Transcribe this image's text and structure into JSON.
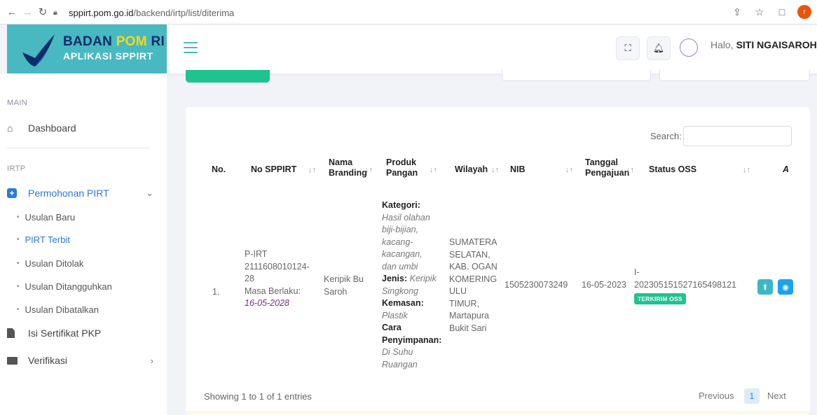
{
  "browser": {
    "url_domain": "sppirt.pom.go.id",
    "url_path": "/backend/irtp/list/diterima",
    "profile_initial": "r"
  },
  "logo": {
    "line1_a": "BADAN",
    "line1_b": "POM",
    "line1_c": "RI",
    "line2": "APLIKASI SPPIRT"
  },
  "header": {
    "greeting_prefix": "Halo,",
    "user_name": "SITI NGAISAROH"
  },
  "sidebar": {
    "section_main": "MAIN",
    "dashboard": "Dashboard",
    "section_irtp": "IRTP",
    "permohonan": "Permohonan PIRT",
    "sub_items": [
      "Usulan Baru",
      "PIRT Terbit",
      "Usulan Ditolak",
      "Usulan Ditangguhkan",
      "Usulan Dibatalkan"
    ],
    "isi_sertifikat": "Isi Sertifikat PKP",
    "verifikasi": "Verifikasi"
  },
  "table": {
    "search_label": "Search:",
    "headers": {
      "no": "No.",
      "no_sppirt": "No SPPIRT",
      "nama_branding_1": "Nama",
      "nama_branding_2": "Branding",
      "produk_1": "Produk",
      "produk_2": "Pangan",
      "wilayah": "Wilayah",
      "nib": "NIB",
      "tanggal_1": "Tanggal",
      "tanggal_2": "Pengajuan",
      "status_oss": "Status OSS",
      "aksi_partial": "A"
    },
    "row": {
      "no": "1.",
      "sppirt_1": "P-IRT",
      "sppirt_2": "2111608010124-",
      "sppirt_3": "28",
      "masa_label": "Masa Berlaku:",
      "masa_date": "16-05-2028",
      "branding_1": "Keripik Bu",
      "branding_2": "Saroh",
      "kategori_label": "Kategori:",
      "kategori_1": "Hasil olahan",
      "kategori_2": "biji-bijian,",
      "kategori_3": "kacang-",
      "kategori_4": "kacangan,",
      "kategori_5": "dan umbi",
      "jenis_label": "Jenis:",
      "jenis_1": "Keripik",
      "jenis_2": "Singkong",
      "kemasan_label": "Kemasan:",
      "kemasan_val": "Plastik",
      "cara_label_1": "Cara",
      "cara_label_2": "Penyimpanan:",
      "cara_1": "Di Suhu",
      "cara_2": "Ruangan",
      "wilayah_1": "SUMATERA",
      "wilayah_2": "SELATAN,",
      "wilayah_3": "KAB. OGAN",
      "wilayah_4": "KOMERING",
      "wilayah_5": "ULU",
      "wilayah_6": "TIMUR,",
      "wilayah_7": "Martapura",
      "wilayah_8": "Bukit Sari",
      "nib": "1505230073249",
      "tanggal": "16-05-2023",
      "oss_1": "I-",
      "oss_2": "202305151527165498121",
      "oss_badge": "TERKIRIM OSS"
    },
    "showing": "Showing 1 to 1 of 1 entries",
    "prev": "Previous",
    "page": "1",
    "next": "Next"
  }
}
